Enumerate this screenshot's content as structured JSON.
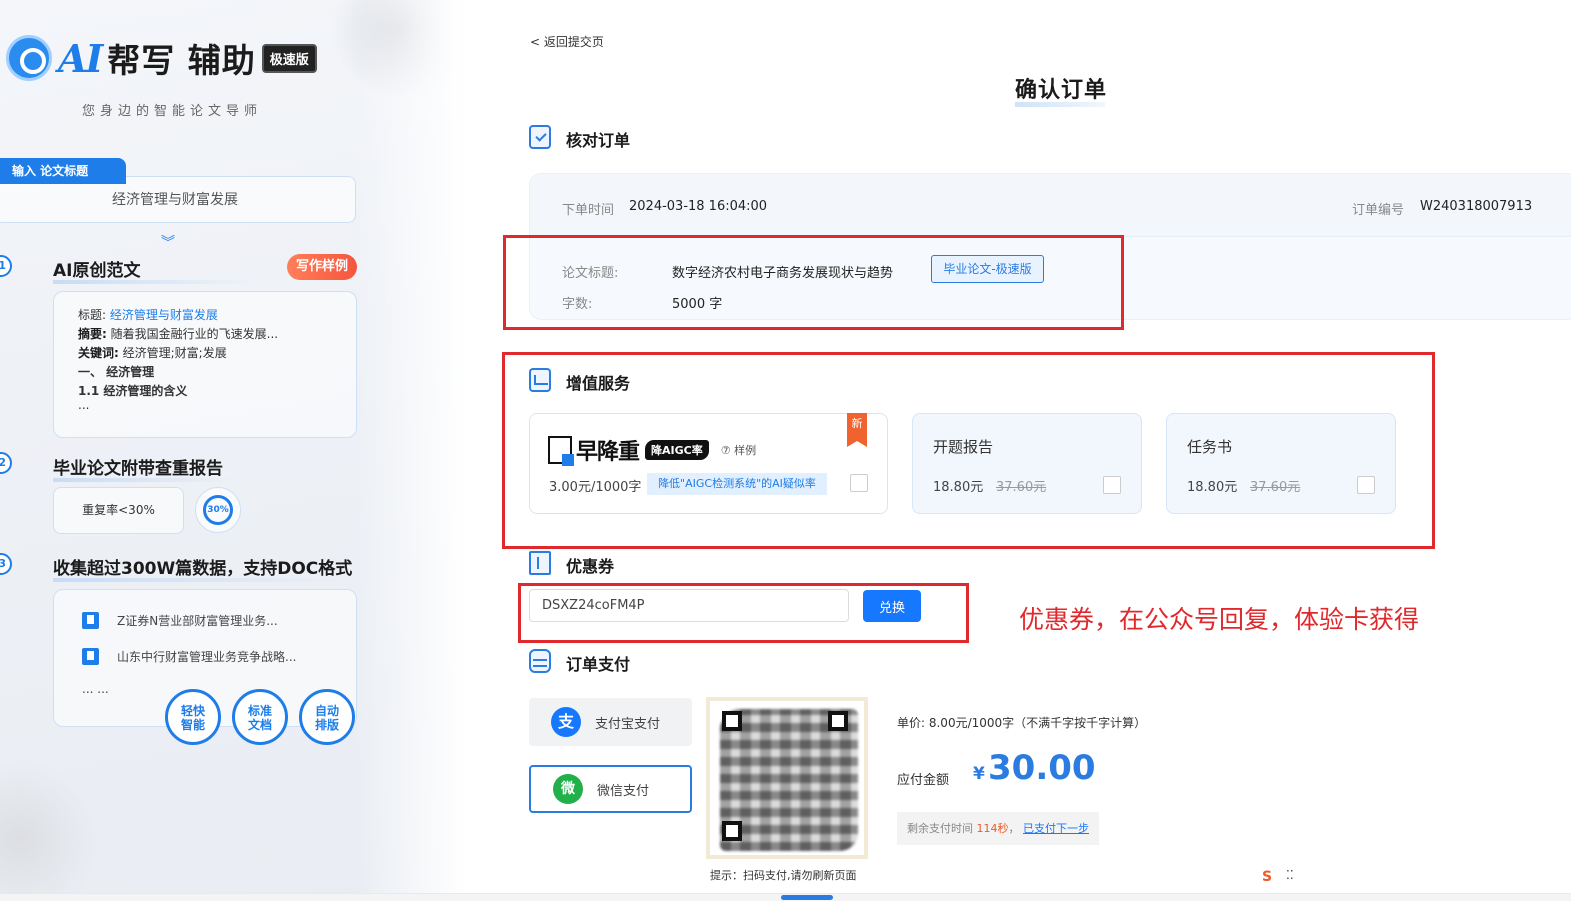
{
  "left": {
    "logo_ai": "AI",
    "logo_text": "帮写 辅助",
    "logo_badge": "极速版",
    "slogan": "您身边的智能论文导师",
    "input_tag": "输入 论文标题",
    "input_value": "经济管理与财富发展",
    "steps": [
      {
        "num": "1",
        "title": "AI原创范文"
      },
      {
        "num": "2",
        "title": "毕业论文附带查重报告"
      },
      {
        "num": "3",
        "title": "收集超过300W篇数据，支持DOC格式"
      }
    ],
    "sample_badge": "写作样例",
    "sample": {
      "title_label": "标题:",
      "title_value": "经济管理与财富发展",
      "abstract_label": "摘要:",
      "abstract_value": "随着我国金融行业的飞速发展...",
      "keywords_label": "关键词:",
      "keywords_value": "经济管理;财富;发展",
      "line1": "一、 经济管理",
      "line2": "1.1 经济管理的含义",
      "more": "..."
    },
    "report": {
      "label": "重复率<30%",
      "ring": "30%"
    },
    "docs": [
      "Z证券N营业部财富管理业务...",
      "山东中行财富管理业务竞争战略..."
    ],
    "docs_more": "... ...",
    "features": [
      "轻快智能",
      "标准文档",
      "自动排版"
    ]
  },
  "header": {
    "back_link": "< 返回提交页",
    "title": "确认订单"
  },
  "verify": {
    "heading": "核对订单",
    "order_time_label": "下单时间",
    "order_time": "2024-03-18 16:04:00",
    "order_no_label": "订单编号",
    "order_no": "W240318007913",
    "topic_label": "论文标题:",
    "topic": "数字经济农村电子商务发展现状与趋势",
    "topic_tag": "毕业论文-极速版",
    "words_label": "字数:",
    "words": "5000 字"
  },
  "services": {
    "heading": "增值服务",
    "main": {
      "brand": "早降重",
      "tag": "降AIGC率",
      "sample": "⑦ 样例",
      "price": "3.00元/1000字",
      "note": "降低\"AIGC检测系统\"的AI疑似率",
      "new_tag": "新"
    },
    "items": [
      {
        "name": "开题报告",
        "price": "18.80元",
        "old": "37.60元"
      },
      {
        "name": "任务书",
        "price": "18.80元",
        "old": "37.60元"
      }
    ]
  },
  "coupon": {
    "heading": "优惠券",
    "value": "DSXZ24coFM4P",
    "button": "兑换",
    "annotation": "优惠券，在公众号回复，体验卡获得"
  },
  "payment": {
    "heading": "订单支付",
    "alipay": "支付宝支付",
    "wechat": "微信支付",
    "alipay_icon": "支",
    "wechat_icon": "微",
    "qr_hint": "提示：扫码支付,请勿刷新页面",
    "unit_price": "单价: 8.00元/1000字（不满千字按千字计算）",
    "due_label": "应付金额",
    "currency": "¥",
    "amount": "30.00",
    "remain_prefix": "剩余支付时间",
    "remain_seconds": "114秒",
    "remain_sep": "，",
    "paid_link": "已支付下一步"
  },
  "toolbar": {
    "icon1": "S",
    "icon2": "⁚⁚"
  },
  "colors": {
    "accent": "#1e7de8",
    "annotation_red": "#e0292d",
    "price_orange": "#f05a28"
  }
}
